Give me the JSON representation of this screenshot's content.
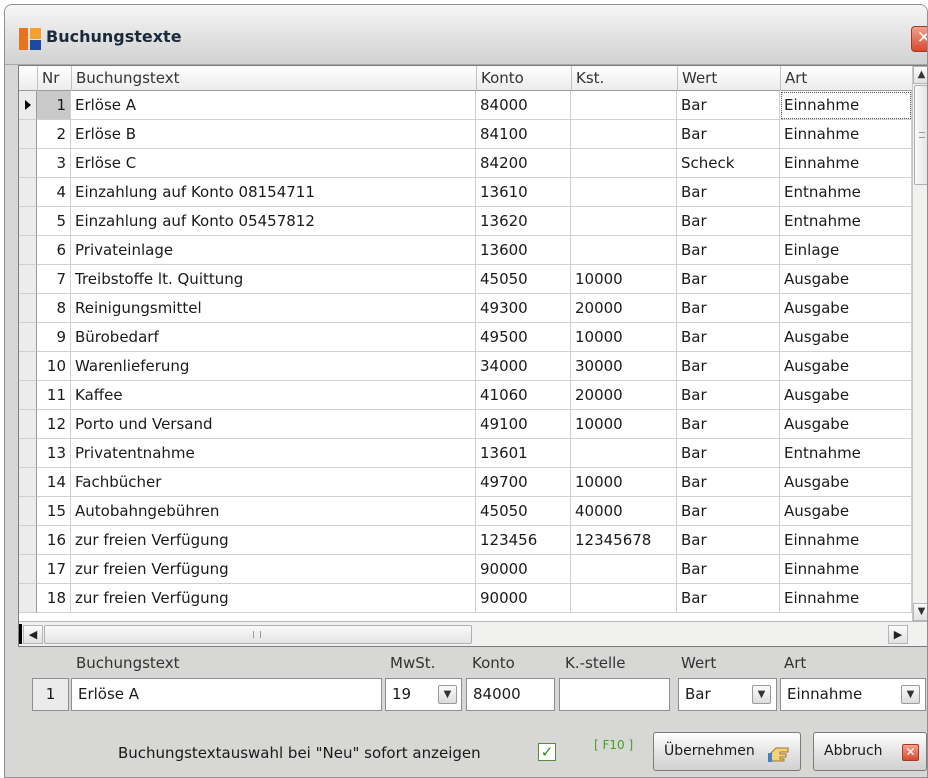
{
  "window": {
    "title": "Buchungstexte",
    "close_glyph": "✕"
  },
  "grid": {
    "columns": [
      "Nr",
      "Buchungstext",
      "Konto",
      "Kst.",
      "Wert",
      "Art"
    ],
    "selected_index": 0,
    "rows": [
      {
        "nr": "1",
        "text": "Erlöse A",
        "konto": "84000",
        "kst": "",
        "wert": "Bar",
        "art": "Einnahme"
      },
      {
        "nr": "2",
        "text": "Erlöse B",
        "konto": "84100",
        "kst": "",
        "wert": "Bar",
        "art": "Einnahme"
      },
      {
        "nr": "3",
        "text": "Erlöse C",
        "konto": "84200",
        "kst": "",
        "wert": "Scheck",
        "art": "Einnahme"
      },
      {
        "nr": "4",
        "text": "Einzahlung auf Konto 08154711",
        "konto": "13610",
        "kst": "",
        "wert": "Bar",
        "art": "Entnahme"
      },
      {
        "nr": "5",
        "text": "Einzahlung auf Konto 05457812",
        "konto": "13620",
        "kst": "",
        "wert": "Bar",
        "art": "Entnahme"
      },
      {
        "nr": "6",
        "text": "Privateinlage",
        "konto": "13600",
        "kst": "",
        "wert": "Bar",
        "art": "Einlage"
      },
      {
        "nr": "7",
        "text": "Treibstoffe lt. Quittung",
        "konto": "45050",
        "kst": "10000",
        "wert": "Bar",
        "art": "Ausgabe"
      },
      {
        "nr": "8",
        "text": "Reinigungsmittel",
        "konto": "49300",
        "kst": "20000",
        "wert": "Bar",
        "art": "Ausgabe"
      },
      {
        "nr": "9",
        "text": "Bürobedarf",
        "konto": "49500",
        "kst": "10000",
        "wert": "Bar",
        "art": "Ausgabe"
      },
      {
        "nr": "10",
        "text": "Warenlieferung",
        "konto": "34000",
        "kst": "30000",
        "wert": "Bar",
        "art": "Ausgabe"
      },
      {
        "nr": "11",
        "text": "Kaffee",
        "konto": "41060",
        "kst": "20000",
        "wert": "Bar",
        "art": "Ausgabe"
      },
      {
        "nr": "12",
        "text": "Porto und Versand",
        "konto": "49100",
        "kst": "10000",
        "wert": "Bar",
        "art": "Ausgabe"
      },
      {
        "nr": "13",
        "text": "Privatentnahme",
        "konto": "13601",
        "kst": "",
        "wert": "Bar",
        "art": "Entnahme"
      },
      {
        "nr": "14",
        "text": "Fachbücher",
        "konto": "49700",
        "kst": "10000",
        "wert": "Bar",
        "art": "Ausgabe"
      },
      {
        "nr": "15",
        "text": "Autobahngebühren",
        "konto": "45050",
        "kst": "40000",
        "wert": "Bar",
        "art": "Ausgabe"
      },
      {
        "nr": "16",
        "text": "zur freien Verfügung",
        "konto": "123456",
        "kst": "12345678",
        "wert": "Bar",
        "art": "Einnahme"
      },
      {
        "nr": "17",
        "text": "zur freien Verfügung",
        "konto": "90000",
        "kst": "",
        "wert": "Bar",
        "art": "Einnahme"
      },
      {
        "nr": "18",
        "text": "zur freien Verfügung",
        "konto": "90000",
        "kst": "",
        "wert": "Bar",
        "art": "Einnahme"
      }
    ]
  },
  "scroll": {
    "up": "▲",
    "down": "▼",
    "left": "◀",
    "right": "▶"
  },
  "edit": {
    "labels": {
      "buchungstext": "Buchungstext",
      "mwst": "MwSt.",
      "konto": "Konto",
      "kstelle": "K.-stelle",
      "wert": "Wert",
      "art": "Art"
    },
    "nr": "1",
    "buchungstext": "Erlöse A",
    "mwst": "19",
    "konto": "84000",
    "kstelle": "",
    "wert": "Bar",
    "art": "Einnahme",
    "dropdown_glyph": "▼"
  },
  "options": {
    "auto_show_label": "Buchungstextauswahl bei \"Neu\" sofort anzeigen",
    "auto_show_checked": true,
    "check_glyph": "✓"
  },
  "shortcut": "[ F10 ]",
  "buttons": {
    "apply": "Übernehmen",
    "cancel": "Abbruch",
    "cancel_glyph": "✕"
  },
  "colors": {
    "window_bg": "#d7d7d5",
    "close_red": "#d9482e",
    "check_green": "#2f8a17",
    "shortcut_green": "#44a023"
  }
}
